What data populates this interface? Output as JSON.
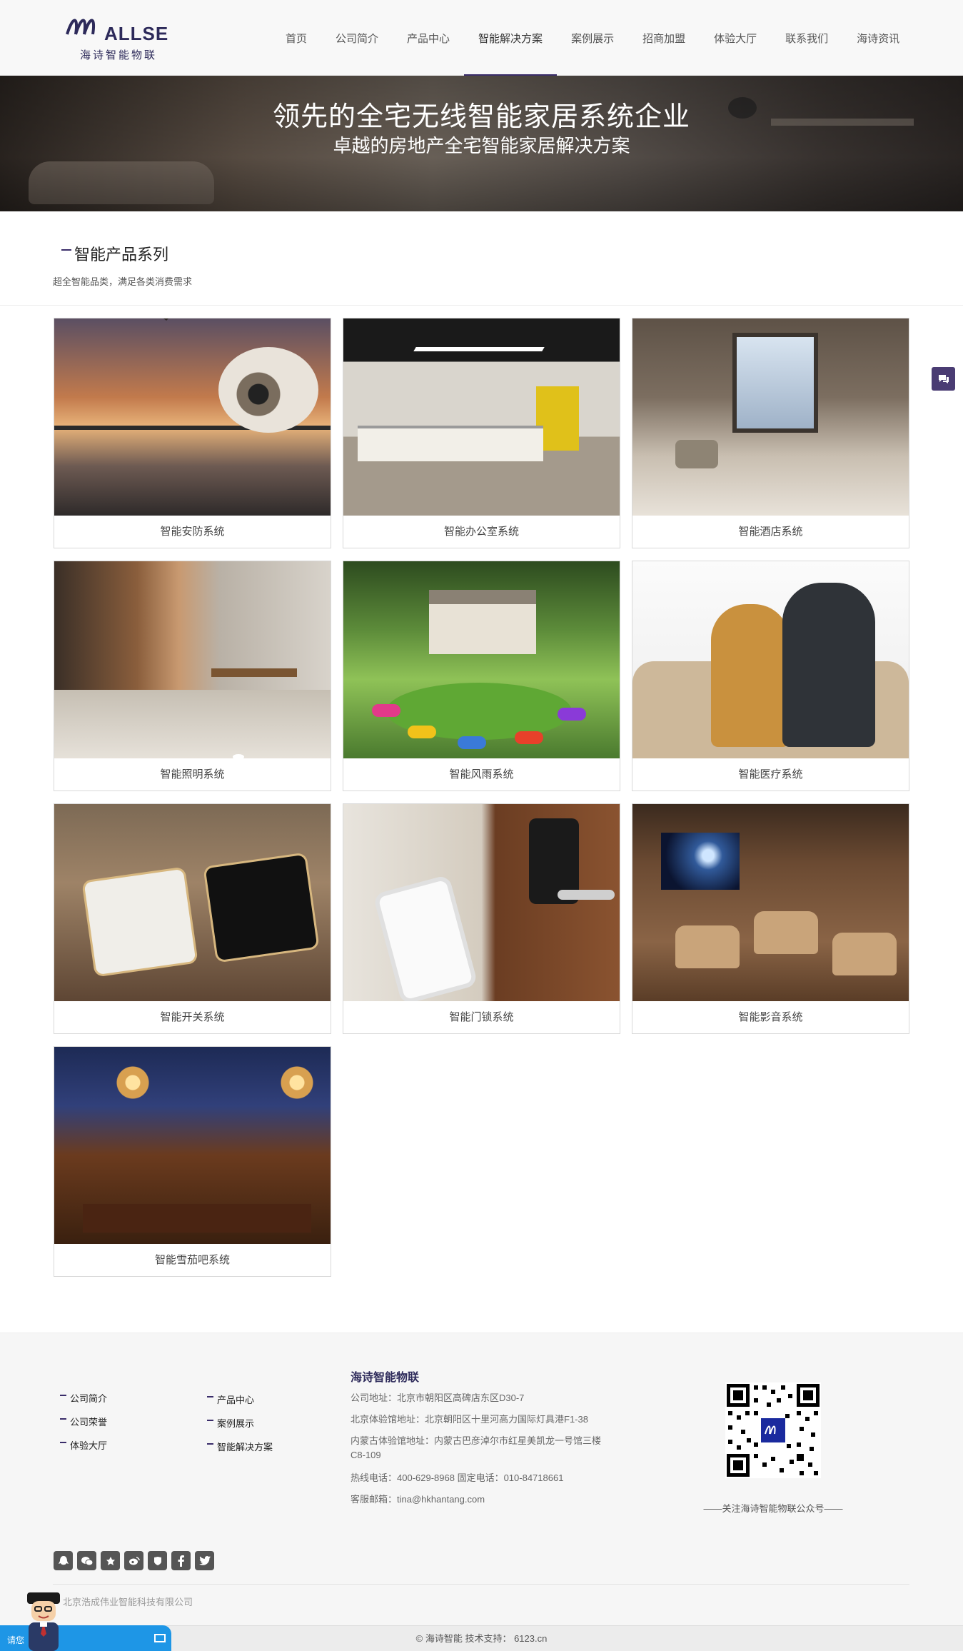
{
  "header": {
    "logo_text": "ALLSE",
    "logo_sub": "海诗智能物联",
    "nav": [
      {
        "label": "首页"
      },
      {
        "label": "公司简介"
      },
      {
        "label": "产品中心"
      },
      {
        "label": "智能解决方案",
        "active": true
      },
      {
        "label": "案例展示"
      },
      {
        "label": "招商加盟"
      },
      {
        "label": "体验大厅"
      },
      {
        "label": "联系我们"
      },
      {
        "label": "海诗资讯"
      }
    ]
  },
  "banner": {
    "title": "领先的全宅无线智能家居系统企业",
    "subtitle": "卓越的房地产全宅智能家居解决方案"
  },
  "section": {
    "title": "智能产品系列",
    "desc": "超全智能品类，满足各类消费需求"
  },
  "products": [
    {
      "caption": "智能安防系统"
    },
    {
      "caption": "智能办公室系统"
    },
    {
      "caption": "智能酒店系统"
    },
    {
      "caption": "智能照明系统"
    },
    {
      "caption": "智能风雨系统"
    },
    {
      "caption": "智能医疗系统"
    },
    {
      "caption": "智能开关系统"
    },
    {
      "caption": "智能门锁系统"
    },
    {
      "caption": "智能影音系统"
    },
    {
      "caption": "智能雪茄吧系统"
    }
  ],
  "footer": {
    "links_col1": [
      "公司简介",
      "公司荣誉",
      "体验大厅"
    ],
    "links_col2": [
      "产品中心",
      "案例展示",
      "智能解决方案"
    ],
    "company": "海诗智能物联",
    "address": "公司地址：北京市朝阳区高碑店东区D30-7",
    "showroom_bj": "北京体验馆地址：北京朝阳区十里河高力国际灯具港F1-38",
    "showroom_nm": "内蒙古体验馆地址：内蒙古巴彦淖尔市红星美凯龙一号馆三楼C8-109",
    "phones": "热线电话：400-629-8968   固定电话：010-84718661",
    "email": "客服邮箱：tina@hkhantang.com",
    "qr_caption": "——关注海诗智能物联公众号——",
    "copyright": "北京浩成伟业智能科技有限公司",
    "bottom": "© 海诗智能    技术支持： 6123.cn",
    "social_icons": [
      "qq-icon",
      "wechat-icon",
      "star-icon",
      "weibo-icon",
      "shield-icon",
      "facebook-icon",
      "twitter-icon"
    ]
  },
  "chat": {
    "label": "请您"
  }
}
